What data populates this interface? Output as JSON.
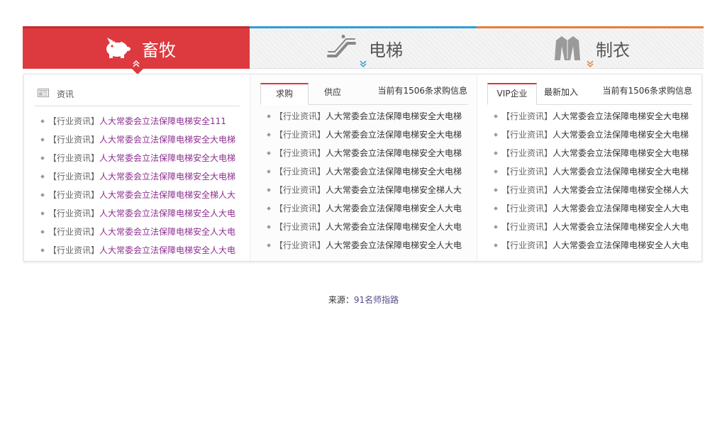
{
  "tabs": [
    {
      "label": "畜牧",
      "icon": "pig-icon",
      "accent": "#dc3a3f"
    },
    {
      "label": "电梯",
      "icon": "escalator-icon",
      "accent": "#2f9ed8"
    },
    {
      "label": "制衣",
      "icon": "coat-icon",
      "accent": "#e57f3a"
    }
  ],
  "col1": {
    "header": "资讯",
    "items": [
      {
        "cat": "【行业资讯】",
        "title": "人大常委会立法保障电梯安全111"
      },
      {
        "cat": "【行业资讯】",
        "title": "人大常委会立法保障电梯安全大电梯"
      },
      {
        "cat": "【行业资讯】",
        "title": "人大常委会立法保障电梯安全大电梯"
      },
      {
        "cat": "【行业资讯】",
        "title": "人大常委会立法保障电梯安全大电梯"
      },
      {
        "cat": "【行业资讯】",
        "title": "人大常委会立法保障电梯安全梯人大"
      },
      {
        "cat": "【行业资讯】",
        "title": "人大常委会立法保障电梯安全人大电"
      },
      {
        "cat": "【行业资讯】",
        "title": "人大常委会立法保障电梯安全人大电"
      },
      {
        "cat": "【行业资讯】",
        "title": "人大常委会立法保障电梯安全人大电"
      }
    ]
  },
  "col2": {
    "tab_active": "求购",
    "tab_other": "供应",
    "count": "当前有1506条求购信息",
    "items": [
      {
        "cat": "【行业资讯】",
        "title": "人大常委会立法保障电梯安全大电梯"
      },
      {
        "cat": "【行业资讯】",
        "title": "人大常委会立法保障电梯安全大电梯"
      },
      {
        "cat": "【行业资讯】",
        "title": "人大常委会立法保障电梯安全大电梯"
      },
      {
        "cat": "【行业资讯】",
        "title": "人大常委会立法保障电梯安全大电梯"
      },
      {
        "cat": "【行业资讯】",
        "title": "人大常委会立法保障电梯安全梯人大"
      },
      {
        "cat": "【行业资讯】",
        "title": "人大常委会立法保障电梯安全人大电"
      },
      {
        "cat": "【行业资讯】",
        "title": "人大常委会立法保障电梯安全人大电"
      },
      {
        "cat": "【行业资讯】",
        "title": "人大常委会立法保障电梯安全人大电"
      }
    ]
  },
  "col3": {
    "tab_active": "VIP企业",
    "tab_other": "最新加入",
    "count": "当前有1506条求购信息",
    "items": [
      {
        "cat": "【行业资讯】",
        "title": "人大常委会立法保障电梯安全大电梯"
      },
      {
        "cat": "【行业资讯】",
        "title": "人大常委会立法保障电梯安全大电梯"
      },
      {
        "cat": "【行业资讯】",
        "title": "人大常委会立法保障电梯安全大电梯"
      },
      {
        "cat": "【行业资讯】",
        "title": "人大常委会立法保障电梯安全大电梯"
      },
      {
        "cat": "【行业资讯】",
        "title": "人大常委会立法保障电梯安全梯人大"
      },
      {
        "cat": "【行业资讯】",
        "title": "人大常委会立法保障电梯安全人大电"
      },
      {
        "cat": "【行业资讯】",
        "title": "人大常委会立法保障电梯安全人大电"
      },
      {
        "cat": "【行业资讯】",
        "title": "人大常委会立法保障电梯安全人大电"
      }
    ]
  },
  "footer": {
    "prefix": "来源：",
    "link": "91名师指路"
  }
}
